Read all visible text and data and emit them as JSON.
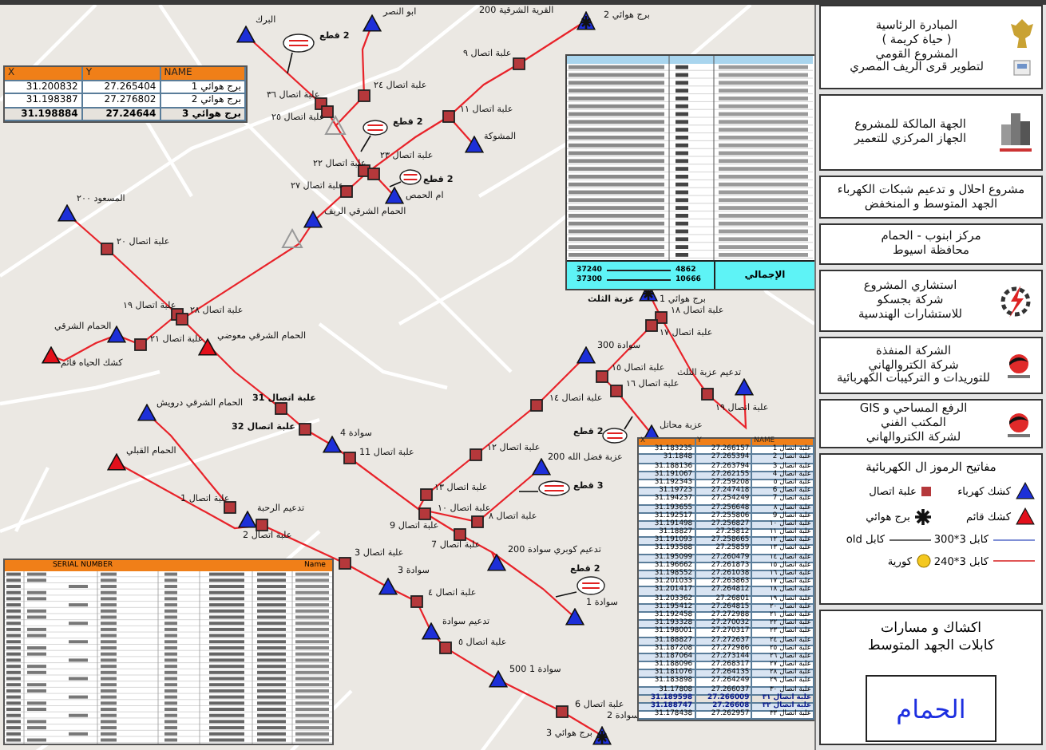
{
  "coordinate_table_top": {
    "columns": [
      "NAME",
      "Y",
      "X"
    ],
    "rows": [
      {
        "cells": [
          "برج هوائي 1",
          "27.265404",
          "31.200832"
        ],
        "bold": false
      },
      {
        "cells": [
          "برج هوائي 2",
          "27.276802",
          "31.198387"
        ],
        "bold": false
      },
      {
        "cells": [
          "برج هوائي 3",
          "27.24644",
          "31.198884"
        ],
        "bold": true
      }
    ]
  },
  "cable_table": {
    "total_label": "الإجمالي",
    "totals": [
      [
        "4862",
        "37240"
      ],
      [
        "10666",
        "37300"
      ]
    ]
  },
  "map": {
    "nodes": [
      {
        "kind": "tower",
        "label": "برج هوائي 2",
        "bold": false
      },
      {
        "kind": "place",
        "label": "القرية الشرقية 200",
        "bold": false
      },
      {
        "kind": "kiosk",
        "label": "ابو النصر",
        "bold": false
      },
      {
        "kind": "kiosk",
        "label": "البرك",
        "bold": false
      },
      {
        "kind": "junction",
        "label": "علبة اتصال ٢٤",
        "bold": false
      },
      {
        "kind": "junction",
        "label": "علبة اتصال ٣٦",
        "bold": false
      },
      {
        "kind": "junction",
        "label": "علبة اتصال ٢٥",
        "bold": false
      },
      {
        "kind": "junction",
        "label": "علبة اتصال ٢٢",
        "bold": false
      },
      {
        "kind": "junction",
        "label": "علبة اتصال ٢٣",
        "bold": false
      },
      {
        "kind": "junction",
        "label": "علبة اتصال ٢٧",
        "bold": false
      },
      {
        "kind": "kiosk",
        "label": "ام الحمص",
        "bold": false
      },
      {
        "kind": "kiosk",
        "label": "الحمام الشرقي الريف",
        "bold": false
      },
      {
        "kind": "kiosk",
        "label": "المسعود ٢٠٠",
        "bold": false
      },
      {
        "kind": "junction",
        "label": "علبة اتصال ٢٠",
        "bold": false
      },
      {
        "kind": "junction",
        "label": "علبة اتصال ١٩",
        "bold": false
      },
      {
        "kind": "junction",
        "label": "علبة اتصال ٢٨",
        "bold": false
      },
      {
        "kind": "kiosk",
        "label": "الحمام الشرقي",
        "bold": false
      },
      {
        "kind": "junction",
        "label": "علبة اتصال ٢١",
        "bold": false
      },
      {
        "kind": "existing",
        "label": "كشك الحياه قائم",
        "bold": false
      },
      {
        "kind": "existing",
        "label": "الحمام الشرقي معوضي",
        "bold": false
      },
      {
        "kind": "kiosk",
        "label": "الحمام الشرقي درويش",
        "bold": false
      },
      {
        "kind": "existing",
        "label": "الحمام القبلي",
        "bold": false
      },
      {
        "kind": "junction",
        "label": "علبة اتصال 31",
        "bold": true
      },
      {
        "kind": "junction",
        "label": "علبة اتصال 32",
        "bold": true
      },
      {
        "kind": "kiosk",
        "label": "سوادة 4",
        "bold": false
      },
      {
        "kind": "junction",
        "label": "علبة اتصال 11",
        "bold": false
      },
      {
        "kind": "junction",
        "label": "علبة اتصال 1",
        "bold": false
      },
      {
        "kind": "kiosk",
        "label": "تدعيم الرحبة",
        "bold": false
      },
      {
        "kind": "junction",
        "label": "علبة اتصال 2",
        "bold": false
      },
      {
        "kind": "junction",
        "label": "علبة اتصال 3",
        "bold": false
      },
      {
        "kind": "kiosk",
        "label": "سوادة 3",
        "bold": false
      },
      {
        "kind": "junction",
        "label": "علبة اتصال ٤",
        "bold": false
      },
      {
        "kind": "kiosk",
        "label": "تدعيم سوادة",
        "bold": false
      },
      {
        "kind": "junction",
        "label": "علبة اتصال ٥",
        "bold": false
      },
      {
        "kind": "kiosk",
        "label": "سوادة 1 500",
        "bold": false
      },
      {
        "kind": "junction",
        "label": "علبة اتصال 6",
        "bold": false
      },
      {
        "kind": "tower",
        "label": "برج هوائي 3",
        "bold": false
      },
      {
        "kind": "place",
        "label": "سوادة 2",
        "bold": false
      },
      {
        "kind": "kiosk",
        "label": "سوادة 1",
        "bold": false
      },
      {
        "kind": "junction",
        "label": "علبة اتصال ١٤",
        "bold": false
      },
      {
        "kind": "junction",
        "label": "علبة اتصال ١٢",
        "bold": false
      },
      {
        "kind": "junction",
        "label": "علبة اتصال ١٣",
        "bold": false
      },
      {
        "kind": "junction",
        "label": "علبة اتصال ١٠",
        "bold": false
      },
      {
        "kind": "place",
        "label": "علبة اتصال 9",
        "bold": false
      },
      {
        "kind": "junction",
        "label": "علبة اتصال ٨",
        "bold": false
      },
      {
        "kind": "junction",
        "label": "علبة اتصال 7",
        "bold": false
      },
      {
        "kind": "kiosk",
        "label": "عزبة فضل الله 200",
        "bold": false
      },
      {
        "kind": "kiosk",
        "label": "تدعيم كوبري سوادة 200",
        "bold": false
      },
      {
        "kind": "kiosk",
        "label": "سوادة 300",
        "bold": false
      },
      {
        "kind": "tower",
        "label": "برج هوائي 1",
        "bold": false
      },
      {
        "kind": "place",
        "label": "عزبة الثلث",
        "bold": true
      },
      {
        "kind": "junction",
        "label": "علبة اتصال ١٨",
        "bold": false
      },
      {
        "kind": "junction",
        "label": "علبة اتصال ١٧",
        "bold": false
      },
      {
        "kind": "junction",
        "label": "علبة اتصال ١٥",
        "bold": false
      },
      {
        "kind": "junction",
        "label": "علبة اتصال ١٦",
        "bold": false
      },
      {
        "kind": "junction",
        "label": "علبة اتصال ١٩",
        "bold": false
      },
      {
        "kind": "kiosk",
        "label": "تدعيم عزبة الثلث",
        "bold": false
      },
      {
        "kind": "kiosk",
        "label": "عزبة محاتل",
        "bold": false
      },
      {
        "kind": "junction",
        "label": "علبة اتصال ٩",
        "bold": false
      },
      {
        "kind": "junction",
        "label": "علبة اتصال ١١",
        "bold": false
      },
      {
        "kind": "kiosk",
        "label": "المشوكة",
        "bold": false
      }
    ],
    "cut_callouts": [
      {
        "label": "2 قطع"
      },
      {
        "label": "2 قطع"
      },
      {
        "label": "2 قطع"
      },
      {
        "label": "2 قطع"
      },
      {
        "label": "3 قطع"
      },
      {
        "label": "2 قطع"
      }
    ]
  },
  "data_table": {
    "columns": [
      "Name",
      "SERIAL NUMBER"
    ]
  },
  "coordinate_table_bottom": {
    "columns": [
      "NAME",
      "Y",
      "X"
    ],
    "rows": [
      {
        "cells": [
          "علبة اتصال 1",
          "27.266157",
          "31.183235"
        ],
        "bold": false
      },
      {
        "cells": [
          "علبة اتصال 2",
          "27.265394",
          "31.1848"
        ],
        "bold": false
      },
      {
        "cells": [
          "علبة اتصال 3",
          "27.263794",
          "31.188136"
        ],
        "bold": false
      },
      {
        "cells": [
          "علبة اتصال 4",
          "27.262155",
          "31.191067"
        ],
        "bold": false
      },
      {
        "cells": [
          "علبة اتصال ٥",
          "27.259208",
          "31.192343"
        ],
        "bold": false
      },
      {
        "cells": [
          "علبة اتصال 6",
          "27.247418",
          "31.19723"
        ],
        "bold": false
      },
      {
        "cells": [
          "علبة اتصال 7",
          "27.254249",
          "31.194237"
        ],
        "bold": false
      },
      {
        "cells": [
          "علبة اتصال ٨",
          "27.256648",
          "31.193655"
        ],
        "bold": false
      },
      {
        "cells": [
          "علبة اتصال 9",
          "27.255806",
          "31.192517"
        ],
        "bold": false
      },
      {
        "cells": [
          "علبة اتصال ١٠",
          "27.256827",
          "31.191498"
        ],
        "bold": false
      },
      {
        "cells": [
          "علبة اتصال ١١",
          "27.25812",
          "31.18827"
        ],
        "bold": false
      },
      {
        "cells": [
          "علبة اتصال ١٢",
          "27.258665",
          "31.191093"
        ],
        "bold": false
      },
      {
        "cells": [
          "علبة اتصال ١٣",
          "27.25859",
          "31.193588"
        ],
        "bold": false
      },
      {
        "cells": [
          "علبة اتصال ١٤",
          "27.260479",
          "31.195099"
        ],
        "bold": false
      },
      {
        "cells": [
          "علبة اتصال ١٥",
          "27.261873",
          "31.196662"
        ],
        "bold": false
      },
      {
        "cells": [
          "علبة اتصال ١٦",
          "27.261038",
          "31.198552"
        ],
        "bold": false
      },
      {
        "cells": [
          "علبة اتصال ١٧",
          "27.263863",
          "31.201033"
        ],
        "bold": false
      },
      {
        "cells": [
          "علبة اتصال ١٨",
          "27.264812",
          "31.201417"
        ],
        "bold": false
      },
      {
        "cells": [
          "علبة اتصال ١٩",
          "27.26801",
          "31.203362"
        ],
        "bold": false
      },
      {
        "cells": [
          "علبة اتصال ٢٠",
          "27.264815",
          "31.195412"
        ],
        "bold": false
      },
      {
        "cells": [
          "علبة اتصال ٢١",
          "27.272988",
          "31.192458"
        ],
        "bold": false
      },
      {
        "cells": [
          "علبة اتصال ٢٢",
          "27.270032",
          "31.193328"
        ],
        "bold": false
      },
      {
        "cells": [
          "علبة اتصال ٢٣",
          "27.270317",
          "31.198001"
        ],
        "bold": false
      },
      {
        "cells": [
          "علبة اتصال ٢٤",
          "27.272637",
          "31.188827"
        ],
        "bold": false
      },
      {
        "cells": [
          "علبة اتصال ٢٥",
          "27.272986",
          "31.187208"
        ],
        "bold": false
      },
      {
        "cells": [
          "علبة اتصال ٢٦",
          "27.273144",
          "31.187064"
        ],
        "bold": false
      },
      {
        "cells": [
          "علبة اتصال ٢٧",
          "27.268317",
          "31.188096"
        ],
        "bold": false
      },
      {
        "cells": [
          "علبة اتصال ٢٨",
          "27.264135",
          "31.181076"
        ],
        "bold": false
      },
      {
        "cells": [
          "علبة اتصال ٢٩",
          "27.264249",
          "31.183898"
        ],
        "bold": false
      },
      {
        "cells": [
          "علبة اتصال ٣٠",
          "27.266037",
          "31.17808"
        ],
        "bold": false
      },
      {
        "cells": [
          "علبة اتصال ٣١",
          "27.266009",
          "31.189598"
        ],
        "bold": true
      },
      {
        "cells": [
          "علبة اتصال ٣٢",
          "27.26608",
          "31.188747"
        ],
        "bold": true
      },
      {
        "cells": [
          "علبة اتصال ٣٣",
          "27.262957",
          "31.178438"
        ],
        "bold": false
      }
    ]
  },
  "panel": {
    "sections": [
      {
        "kind": "emblem",
        "lines": [
          "المبادرة الرئاسية",
          "( حياة كريمة )",
          "المشروع القومي",
          "لتطوير قرى الريف المصري"
        ]
      },
      {
        "kind": "building",
        "lines": [
          "الجهة المالكة للمشروع",
          "الجهاز المركزي للتعمير"
        ]
      },
      {
        "kind": "text",
        "lines": [
          "مشروع احلال و تدعيم شبكات الكهرباء",
          "الجهد المتوسط و المنخفض"
        ]
      },
      {
        "kind": "text",
        "lines": [
          "مركز ابنوب - الحمام",
          "محافظة اسيوط"
        ]
      },
      {
        "kind": "gear",
        "lines": [
          "استشاري المشروع",
          "شركة بجسكو",
          "للاستشارات الهندسية"
        ]
      },
      {
        "kind": "company",
        "lines": [
          "الشركة المنفذة",
          "شركة الكتروالهاني",
          "للتوريدات و التركيبات الكهربائية"
        ]
      },
      {
        "kind": "company",
        "lines": [
          "الرفع المساحي و GIS",
          "المكتب الفني",
          "لشركة الكتروالهاني"
        ]
      }
    ],
    "legend": {
      "title": "مفاتيح الرموز ال الكهربائية",
      "items": [
        {
          "kind": "kiosk",
          "label": "كشك كهرباء"
        },
        {
          "kind": "junction",
          "label": "علبة اتصال"
        },
        {
          "kind": "existing",
          "label": "كشك قائم"
        },
        {
          "kind": "tower",
          "label": "برج هوائي"
        },
        {
          "kind": "cable_300",
          "label": "كابل 3*300"
        },
        {
          "kind": "cable_old",
          "label": "كابل old"
        },
        {
          "kind": "cable_240",
          "label": "كابل 3*240"
        },
        {
          "kind": "coria",
          "label": "كورية"
        }
      ]
    },
    "footer": {
      "lines": [
        "اكشاك و مسارات",
        "كابلات الجهد المتوسط"
      ],
      "title": "الحمام"
    }
  }
}
